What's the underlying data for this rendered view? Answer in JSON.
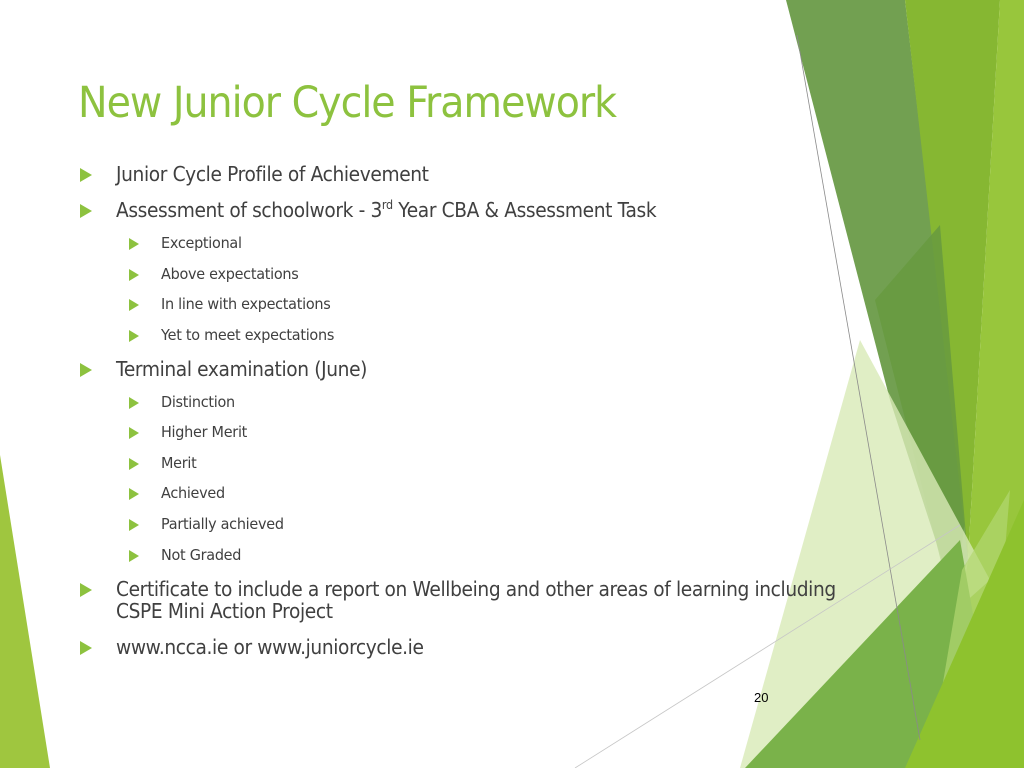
{
  "slide": {
    "title": "New Junior Cycle Framework",
    "bullets": [
      {
        "text": "Junior Cycle Profile of Achievement"
      },
      {
        "text_before": "Assessment of schoolwork - 3",
        "superscript": "rd",
        "text_after": " Year CBA & Assessment Task",
        "subitems": [
          "Exceptional",
          "Above expectations",
          "In line with expectations",
          "Yet to meet expectations"
        ]
      },
      {
        "text": "Terminal examination (June)",
        "subitems": [
          "Distinction",
          "Higher Merit",
          "Merit",
          "Achieved",
          "Partially achieved",
          "Not Graded"
        ]
      },
      {
        "line1": "Certificate to include a report on Wellbeing and other areas of learning including",
        "line2": "CSPE Mini Action Project"
      },
      {
        "text": "www.ncca.ie or www.juniorcycle.ie"
      }
    ],
    "page_number": "20"
  },
  "theme": {
    "accent": "#8dc23f",
    "text_color": "#404040",
    "dark_green": "#6a9a3e",
    "mid_green": "#86b832",
    "light_green": "#9bc83c",
    "pale_green": "#dcebbf"
  }
}
